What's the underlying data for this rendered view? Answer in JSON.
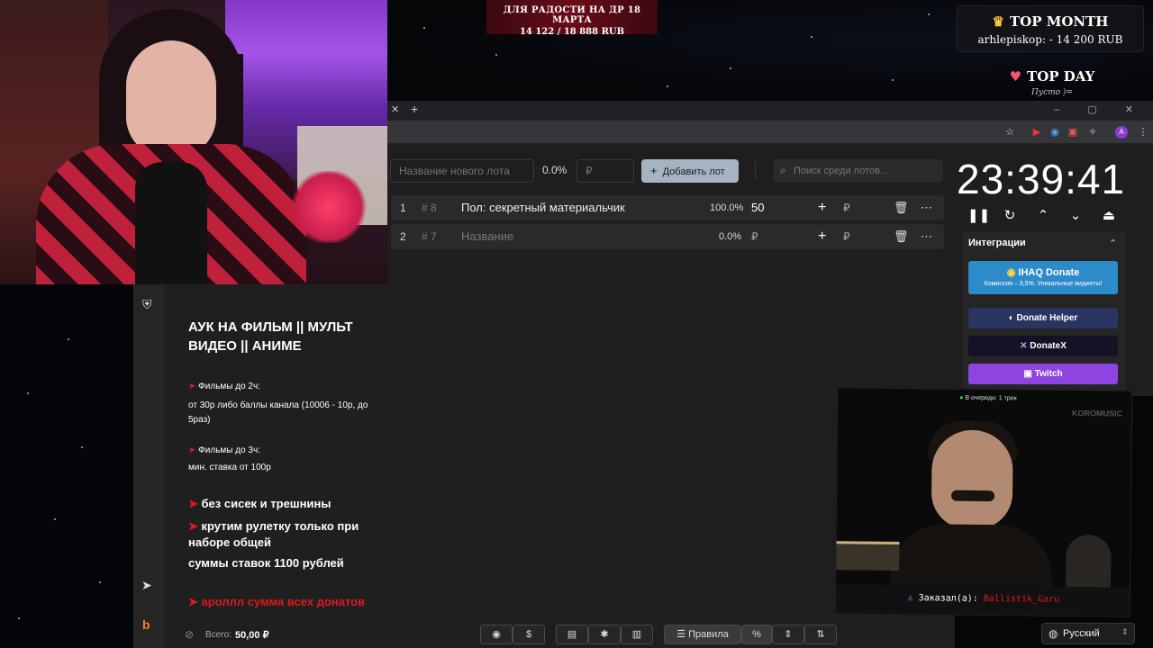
{
  "top_banner": {
    "line1": "ДЛЯ РАДОСТИ НА ДР 18 МАРТА",
    "line2": "14 122 / 18 888 RUB"
  },
  "top_month": {
    "title": "TOP MONTH",
    "value": "arhlepiskop: - 14 200 RUB"
  },
  "top_day": {
    "title": "TOP DAY",
    "value": "Пусто )="
  },
  "lot_form": {
    "name_placeholder": "Название нового лота",
    "percent": "0.0%",
    "amount_placeholder": "₽",
    "add_button": "Добавить лот",
    "search_placeholder": "Поиск среди лотов..."
  },
  "lots": [
    {
      "index": "1",
      "id": "# 8",
      "name": "Пол: секретный материальчик",
      "percent": "100.0%",
      "amount": "50",
      "currency": "₽"
    },
    {
      "index": "2",
      "id": "# 7",
      "name": "Название",
      "percent": "0.0%",
      "amount": "₽",
      "currency": "₽"
    }
  ],
  "timer": {
    "value": "23:39:41"
  },
  "integrations": {
    "title": "Интеграции",
    "ihaq": {
      "name": "IHAQ Donate",
      "sub": "Комиссия – 3,5%. Уникальные виджеты!"
    },
    "donate_helper": "Donate Helper",
    "donatex": "DonateX",
    "twitch": "Twitch"
  },
  "info_panel": {
    "title": "АУК НА ФИЛЬМ || МУЛЬТ ВИДЕО || АНИМЕ",
    "films2_head": "Фильмы до 2ч:",
    "films2_body": "от 30р либо баллы канала (10006 - 10р, до 5раз)",
    "films3_head": "Фильмы до 3ч:",
    "films3_body": "мин. ставка от 100р",
    "rule1": "без сисек и трешнины",
    "rule2": "крутим рулетку только при наборе общей",
    "rule3": "суммы ставок 1100 рублей",
    "rule4": "ароллл сумма всех донатов"
  },
  "bottom_bar": {
    "total_label": "Всего:",
    "total_value": "50,00 ₽",
    "rules_label": "Правила",
    "percent_symbol": "%"
  },
  "language": {
    "value": "Русский"
  },
  "video": {
    "queue": "В очереди: 1 трек",
    "brand": "KOROMUSIC",
    "ordered_label": "Заказал(а):",
    "ordered_user": "Ballistik_Garu"
  },
  "colors": {
    "accent_red": "#e0181f",
    "ihaq_blue": "#2e8bc9",
    "twitch_purple": "#8e44e0",
    "donatex_bg": "#151225",
    "donate_helper_bg": "#2b3563"
  },
  "icons": [
    "github-icon",
    "dollar-icon",
    "save-icon",
    "bug-icon",
    "trash-icon",
    "list-icon",
    "percent-icon",
    "split-icon",
    "sort-icon",
    "pause-icon",
    "restart-icon",
    "chevron-up-icon",
    "chevron-down-icon",
    "eject-icon",
    "shield-icon",
    "telegram-icon",
    "boosty-icon",
    "eye-off-icon",
    "globe-icon",
    "search-icon"
  ]
}
